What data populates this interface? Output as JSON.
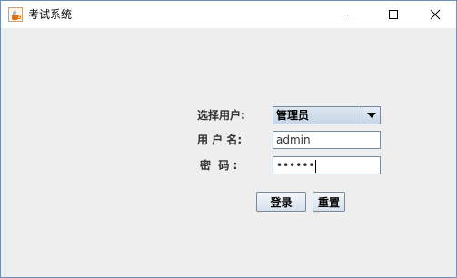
{
  "window": {
    "title": "考试系统",
    "icon": "java-cup-icon"
  },
  "form": {
    "user_type_label": "选择用户:",
    "user_type_value": "管理员",
    "username_label": "用 户 名:",
    "username_value": "admin",
    "password_label": "密  码 :",
    "password_mask": "••••••"
  },
  "buttons": {
    "login": "登录",
    "reset": "重置"
  },
  "colors": {
    "window_bg": "#eeeeee",
    "titlebar_bg": "#ffffff",
    "control_border": "#7a8a99"
  }
}
